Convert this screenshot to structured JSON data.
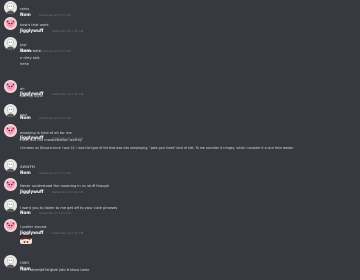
{
  "colors": {
    "background": "#36393f",
    "nom_name": "#ffffff",
    "jiggly_name": "#ffffff",
    "timestamp": "#72767d",
    "text": "#dcddde"
  },
  "messages": [
    {
      "author": "Nom",
      "timestamp": "Yesterday at 7:41 AM",
      "avatar": "nom-avatar",
      "lines": [
        "rahrs"
      ]
    },
    {
      "author": "Jigglywuff",
      "timestamp": "Yesterday at 7:41 AM",
      "avatar": "jiggly-avatar",
      "lines": [
        "how's that work"
      ]
    },
    {
      "author": "Nom",
      "timestamp": "Yesterday at 7:41 AM",
      "avatar": "nom-avatar",
      "lines": [
        "just",
        "masturbate",
        "n dirty talk",
        "hehe"
      ]
    },
    {
      "author": "Jigglywuff",
      "timestamp": "Yesterday at 7:41 AM",
      "avatar": "jiggly-avatar",
      "lines": [
        "ah",
        "Not my style"
      ]
    },
    {
      "author": "Nom",
      "timestamp": "Yesterday at 7:41 AM",
      "avatar": "nom-avatar",
      "lines": [
        "oad"
      ]
    },
    {
      "author": "Jigglywuff",
      "timestamp": "Yesterday at 7:41 AM",
      "avatar": "jiggly-avatar",
      "lines": [
        "moaning is kind of eh for me",
        "cute, but not masturbation worthy",
        "I've been on Discord since I was 15. I was the type of kid that was into roleplaying, \"pats your head\" kind of shit. To me consider it cringey, while I consider it a nice time waster"
      ]
    },
    {
      "author": "Nom",
      "timestamp": "Yesterday at 7:41 AM",
      "avatar": "nom-avatar",
      "lines": [
        "XWWFM"
      ]
    },
    {
      "author": "Jigglywuff",
      "timestamp": "Yesterday at 7:41 AM",
      "avatar": "jiggly-avatar",
      "lines": [
        "Never understood the moaning in vc stuff though"
      ]
    },
    {
      "author": "Nom",
      "timestamp": "Yesterday at 7:41 AM",
      "avatar": "nom-avatar",
      "lines": [
        "I want you to listen to me get off to your cute phrases"
      ]
    },
    {
      "author": "Jigglywuff",
      "timestamp": "Yesterday at 7:41 AM",
      "avatar": "jiggly-avatar",
      "lines": [
        "I prefer visuals"
      ],
      "attachment": "anime-image"
    },
    {
      "author": "Nom",
      "timestamp": "Yesterday at 7:41 AM",
      "avatar": "nom-avatar",
      "lines": [
        "OWO",
        "I can attempt to give you a show hehe"
      ]
    }
  ]
}
